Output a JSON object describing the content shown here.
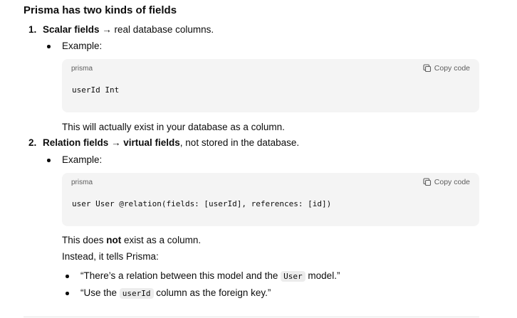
{
  "heading": "Prisma has two kinds of fields",
  "item1": {
    "number": "1.",
    "title": "Scalar fields → real database columns.",
    "title_bold": "Scalar fields",
    "title_rest": " → real database columns.",
    "example_label": "Example:",
    "code": {
      "lang": "prisma",
      "copy_label": "Copy code",
      "content": "userId Int"
    },
    "note": "This will actually exist in your database as a column."
  },
  "item2": {
    "number": "2.",
    "title_bold": "Relation fields → virtual fields",
    "title_rest": ", not stored in the database.",
    "example_label": "Example:",
    "code": {
      "lang": "prisma",
      "copy_label": "Copy code",
      "content": "user User @relation(fields: [userId], references: [id])"
    },
    "note_before": "This does ",
    "note_bold": "not",
    "note_after": " exist as a column.",
    "instead": "Instead, it tells Prisma:",
    "bullets": [
      {
        "before": "“There’s a relation between this model and the ",
        "code": "User",
        "after": " model.”"
      },
      {
        "before": "“Use the ",
        "code": "userId",
        "after": " column as the foreign key.”"
      }
    ]
  },
  "colors": {
    "text": "#0d0d0d",
    "code_bg": "#f4f4f4",
    "muted": "#5d5d5d"
  },
  "icons": {
    "copy": "copy-icon"
  }
}
